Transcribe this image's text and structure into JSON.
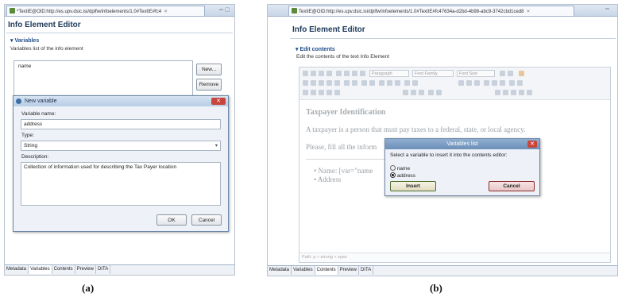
{
  "left": {
    "tab_title": "*TextIE@OID:http://es.upv.dsic.isi/dplfw/infoelements/1.0#TextIE#fc4",
    "editor_title": "Info Element Editor",
    "section_title": "Variables",
    "section_desc": "Variables list of the info element",
    "list_items": [
      "name"
    ],
    "new_button": "New...",
    "remove_button": "Remove",
    "dialog": {
      "title": "New variable",
      "name_label": "Variable name:",
      "name_value": "address",
      "type_label": "Type:",
      "type_value": "String",
      "desc_label": "Description:",
      "desc_value": "Collection of information used for describing the Tax Payer location",
      "ok": "OK",
      "cancel": "Cancel"
    },
    "bottom_tabs": [
      "Metadata",
      "Variables",
      "Contents",
      "Preview",
      "DITA"
    ],
    "active_tab": "Variables",
    "caption": "(a)"
  },
  "right": {
    "tab_title": "TextIE@OID:http://es.upv.dsic.isi/dplfw/infoelements/1.0#TextIE#fc47634a-d2bd-4b98-abc9-3742cbd1ced8",
    "editor_title": "Info Element Editor",
    "section_title": "Edit contents",
    "section_desc": "Edit the contents of the text Info Element",
    "toolbar": {
      "paragraph": "Paragraph",
      "font_family": "Font Family",
      "font_size": "Font Size"
    },
    "content": {
      "heading": "Taxpayer Identification",
      "para1": "A taxpayer is a person that must pay taxes to a federal, state, or local agency.",
      "para2": "Please, fill all the inform",
      "bullet1": "Name: [var=\"name",
      "bullet2": "Address"
    },
    "dialog": {
      "title": "Variables list",
      "prompt": "Select a variable to insert it into the contents editor:",
      "options": [
        "name",
        "address"
      ],
      "selected": "address",
      "insert": "Insert",
      "cancel": "Cancel"
    },
    "path": "Path: p » strong » span",
    "bottom_tabs": [
      "Metadata",
      "Variables",
      "Contents",
      "Preview",
      "DITA"
    ],
    "active_tab": "Contents",
    "caption": "(b)"
  }
}
